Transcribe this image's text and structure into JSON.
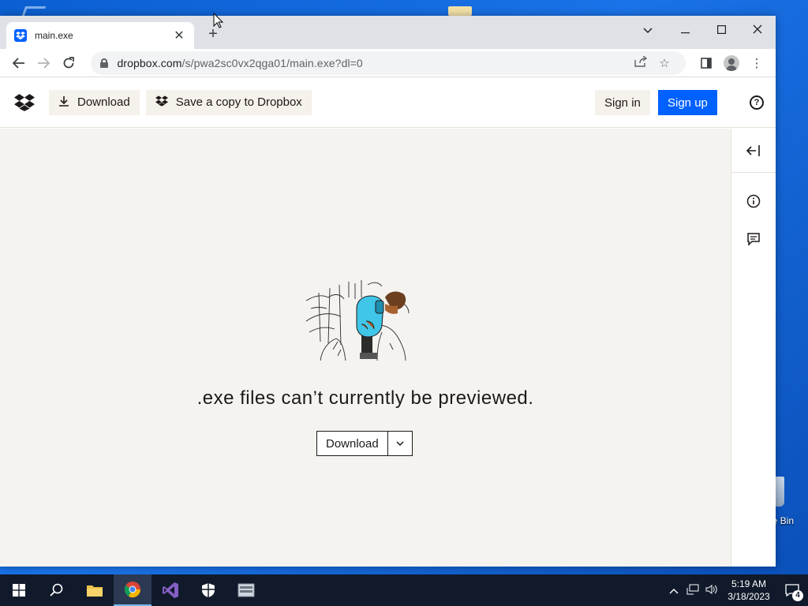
{
  "browser": {
    "tab_title": "main.exe",
    "url_host": "dropbox.com",
    "url_path": "/s/pwa2sc0vx2qga01/main.exe?dl=0"
  },
  "dropbox": {
    "download_label": "Download",
    "save_copy_label": "Save a copy to Dropbox",
    "signin_label": "Sign in",
    "signup_label": "Sign up",
    "help_label": "?",
    "accent_color": "#0061fe"
  },
  "preview": {
    "message": ".exe files can’t currently be previewed.",
    "download_label": "Download"
  },
  "desktop": {
    "recycle_label": "e Bin"
  },
  "taskbar": {
    "time": "5:19 AM",
    "date": "3/18/2023",
    "notifications": "4"
  }
}
